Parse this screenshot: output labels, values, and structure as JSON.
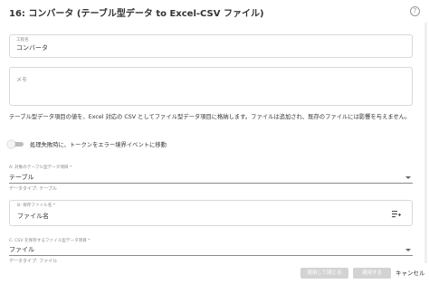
{
  "header": {
    "title": "16: コンバータ (テーブル型データ to Excel-CSV ファイル)",
    "help_icon": "?"
  },
  "step_name": {
    "label": "工程名",
    "value": "コンバータ"
  },
  "memo": {
    "label": "メモ",
    "value": ""
  },
  "description": "テーブル型データ項目の値を、Excel 対応の CSV としてファイル型データ項目に格納します。ファイルは追加され、既存のファイルには影響を与えません。",
  "toggle": {
    "label": "処理失敗時に、トークンをエラー境界イベントに移動",
    "on": false
  },
  "field_a": {
    "label": "A: 対象のテーブル型データ項目 *",
    "value": "テーブル",
    "hint": "データタイプ: テーブル"
  },
  "field_b": {
    "label": "B: 保存ファイル名 *",
    "value": "ファイル名",
    "icon": "insert-variable-icon"
  },
  "field_c": {
    "label": "C: CSV を保存するファイル型データ項目 *",
    "value": "ファイル",
    "hint": "データタイプ: ファイル"
  },
  "footer": {
    "apply_close": "適用して閉じる",
    "apply": "適用する",
    "cancel": "キャンセル"
  }
}
